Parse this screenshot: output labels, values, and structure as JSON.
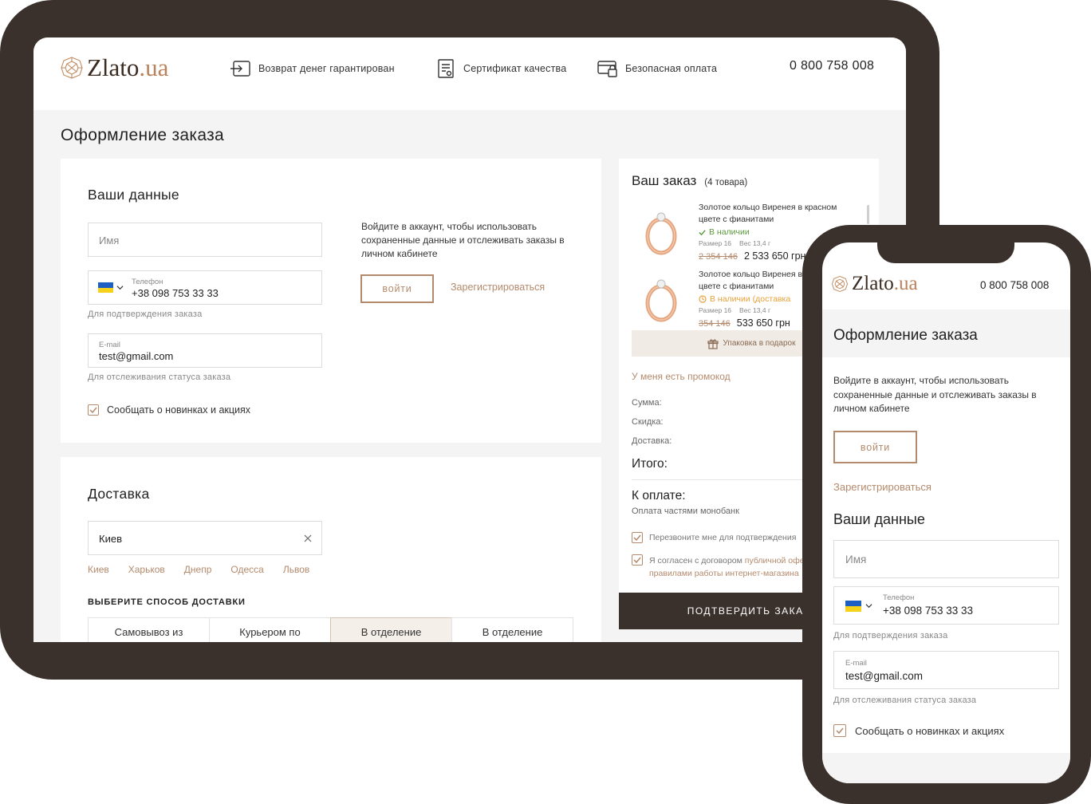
{
  "brand": {
    "name_main": "Zlato",
    "name_suffix": ".ua"
  },
  "tablet": {
    "features": [
      {
        "icon": "money-back-icon",
        "label": "Возврат денег гарантирован"
      },
      {
        "icon": "certificate-icon",
        "label": "Сертификат качества"
      },
      {
        "icon": "secure-payment-icon",
        "label": "Безопасная оплата"
      }
    ],
    "phone_number": "0 800 758 008",
    "page_title": "Оформление заказа",
    "your_data": {
      "title": "Ваши данные",
      "name_placeholder": "Имя",
      "phone_label": "Телефон",
      "phone_value": "+38 098 753 33 33",
      "phone_hint": "Для подтверждения заказа",
      "email_label": "E-mail",
      "email_value": "test@gmail.com",
      "email_hint": "Для отслеживания статуса заказа",
      "newsletter_label": "Сообщать о новинках и акциях",
      "login_text": "Войдите в аккаунт,  чтобы использовать сохраненные данные и  отслеживать заказы в личном кабинете",
      "login_button": "войти",
      "register_link": "Зарегистрироваться"
    },
    "delivery": {
      "title": "Доставка",
      "city_value": "Киев",
      "city_suggestions": [
        "Киев",
        "Харьков",
        "Днепр",
        "Одесса",
        "Львов"
      ],
      "method_title": "ВЫБЕРИТЕ СПОСОБ ДОСТАВКИ",
      "methods": [
        "Самовывоз из",
        "Курьером по",
        "В отделение",
        "В отделение"
      ],
      "active_method_index": 2
    },
    "order": {
      "title": "Ваш заказ",
      "count": "(4 товара)",
      "items": [
        {
          "name": "Золотое кольцо Виренея в красном цвете с фианитами",
          "status": "В наличии",
          "size": "Размер 16",
          "weight": "Вес 13,4 г",
          "old_price": "2 354 146",
          "price": "2 533 650 грн"
        },
        {
          "name": "Золотое кольцо Виренея в красном цвете с фианитами",
          "status": "В наличии (доставка",
          "size": "Размер 16",
          "weight": "Вес 13,4 г",
          "old_price": "354 146",
          "price": "533 650 грн"
        }
      ],
      "gift_wrap": "Упаковка в подарок",
      "promo_link": "У меня есть промокод",
      "sum_label": "Сумма:",
      "discount_label": "Скидка:",
      "shipping_label": "Доставка:",
      "total_label": "Итого:",
      "pay_label": "К оплате:",
      "pay_method": "Оплата частями монобанк",
      "callback_label": "Перезвоните мне для подтверждения",
      "agree_prefix": "Я согласен с договором",
      "agree_link": "публичной оферты",
      "agree_suffix": "правилами работы интернет-магазина",
      "confirm_button": "ПОДТВЕРДИТЬ ЗАКАЗ"
    }
  },
  "phone": {
    "phone_number": "0 800 758 008",
    "page_title": "Оформление заказа",
    "login_text": "Войдите в аккаунт,  чтобы использовать сохраненные данные и  отслеживать заказы в личном кабинете",
    "login_button": "войти",
    "register_link": "Зарегистрироваться",
    "your_data_title": "Ваши данные",
    "name_placeholder": "Имя",
    "phone_label": "Телефон",
    "phone_value": "+38 098 753 33 33",
    "phone_hint": "Для подтверждения заказа",
    "email_label": "E-mail",
    "email_value": "test@gmail.com",
    "email_hint": "Для отслеживания статуса заказа",
    "newsletter_label": "Сообщать о новинках и акциях"
  },
  "colors": {
    "frame": "#3a312c",
    "accent": "#b48a6c",
    "in_stock": "#5a9a3c",
    "delivery_warning": "#e8a13a"
  }
}
